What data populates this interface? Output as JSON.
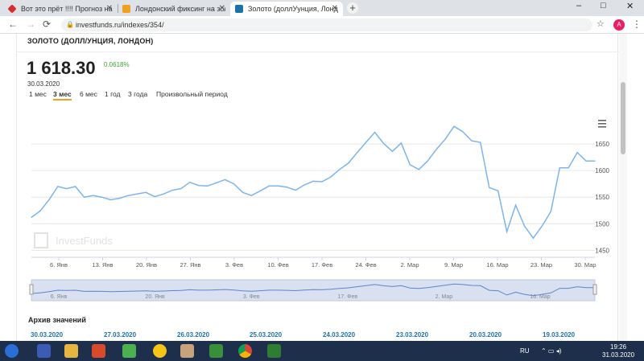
{
  "browser": {
    "tabs": [
      {
        "title": "Вот это прёт !!!! Прогноз на ск",
        "color": "#d32f2f"
      },
      {
        "title": "Лондонский фиксинг на золото",
        "color": "#f0a020"
      },
      {
        "title": "Золото (доллУунция, Лондон) г",
        "color": "#1a73a8"
      }
    ],
    "new_tab_glyph": "+",
    "url": "investfunds.ru/indexes/354/",
    "avatar_letter": "A",
    "win_controls": [
      "–",
      "□",
      "✕"
    ]
  },
  "page": {
    "title": "ЗОЛОТО (ДОЛЛ/УНЦИЯ, ЛОНДОН)",
    "price": "1 618.30",
    "change": "0.0618%",
    "date": "30.03.2020",
    "periods": [
      "1 мес",
      "3 мес",
      "6 мес",
      "1 год",
      "3 года",
      "Произвольный период"
    ],
    "selected_period": "3 мес",
    "watermark": "InvestFunds",
    "archive_title": "Архив значений",
    "archive_dates": [
      "30.03.2020",
      "27.03.2020",
      "26.03.2020",
      "25.03.2020",
      "24.03.2020",
      "23.03.2020",
      "20.03.2020",
      "19.03.2020"
    ]
  },
  "chart_data": {
    "type": "line",
    "series": [
      {
        "values": [
          1512,
          1524,
          1545,
          1570,
          1566,
          1570,
          1550,
          1553,
          1550,
          1545,
          1548,
          1553,
          1556,
          1559,
          1551,
          1556,
          1563,
          1566,
          1578,
          1572,
          1571,
          1577,
          1583,
          1575,
          1559,
          1553,
          1562,
          1571,
          1571,
          1569,
          1563,
          1573,
          1580,
          1579,
          1588,
          1602,
          1614,
          1634,
          1653,
          1672,
          1651,
          1636,
          1652,
          1611,
          1602,
          1618,
          1640,
          1659,
          1683,
          1673,
          1656,
          1653,
          1568,
          1562,
          1485,
          1535,
          1496,
          1473,
          1496,
          1523,
          1605,
          1605,
          1634,
          1618,
          1618
        ]
      }
    ],
    "x_tick_labels": [
      "6. Янв",
      "13. Янв",
      "20. Янв",
      "27. Янв",
      "3. Фев",
      "10. Фев",
      "17. Фев",
      "24. Фев",
      "2. Мар",
      "9. Мар",
      "16. Мар",
      "23. Мар",
      "30. Мар"
    ],
    "y_ticks": [
      1450,
      1500,
      1550,
      1600,
      1650
    ],
    "ylim": [
      1440,
      1700
    ],
    "grid": true,
    "line_color": "#7cb5ec",
    "navigator_labels": [
      "6. Янв",
      "20. Янв",
      "3. Фев",
      "17. Фев",
      "2. Мар",
      "16. Мар"
    ]
  },
  "taskbar": {
    "lang": "RU",
    "time": "19:26",
    "date": "31.03.2020"
  }
}
